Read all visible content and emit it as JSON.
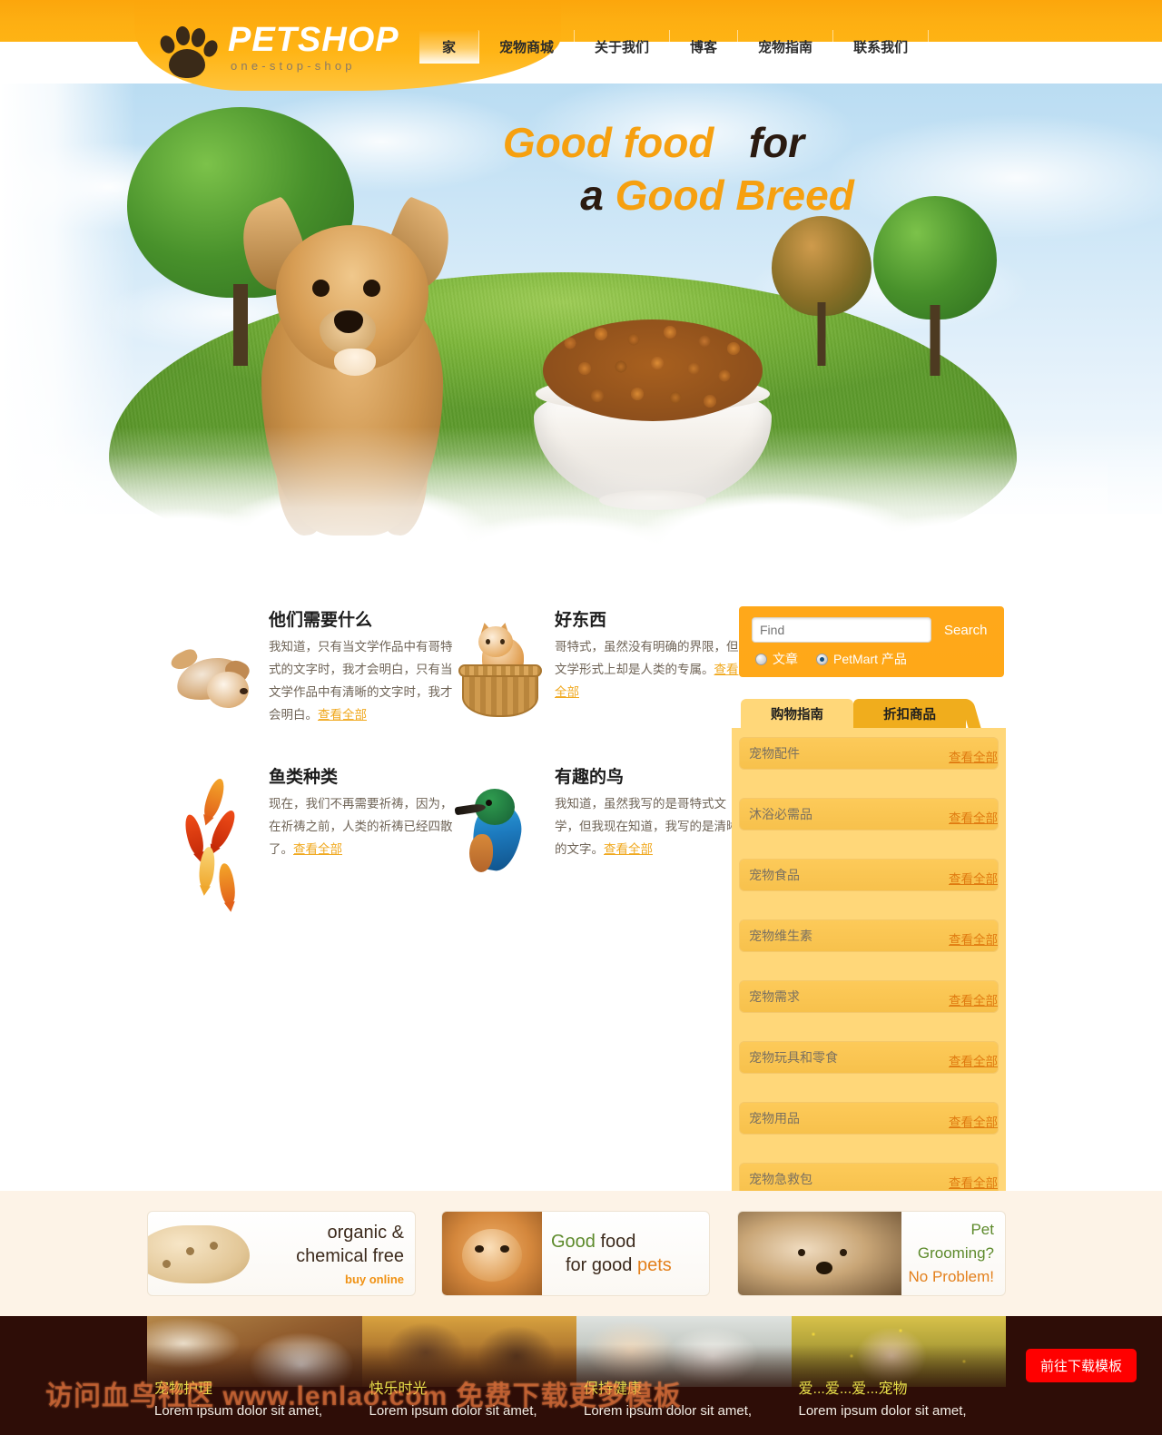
{
  "header": {
    "brand_name": "PETSHOP",
    "brand_tagline": "one-stop-shop",
    "nav": [
      {
        "label": "家",
        "active": true
      },
      {
        "label": "宠物商城",
        "active": false
      },
      {
        "label": "关于我们",
        "active": false
      },
      {
        "label": "博客",
        "active": false
      },
      {
        "label": "宠物指南",
        "active": false
      },
      {
        "label": "联系我们",
        "active": false
      }
    ]
  },
  "hero": {
    "line1_orange": "Good food",
    "line1_dark": "for",
    "line2_dark": "a",
    "line2_orange": "Good Breed"
  },
  "features": [
    {
      "title": "他们需要什么",
      "text": "我知道，只有当文学作品中有哥特式的文字时，我才会明白，只有当文学作品中有清晰的文字时，我才会明白。",
      "link": "查看全部",
      "icon": "puppy-image"
    },
    {
      "title": "好东西",
      "text": "哥特式，虽然没有明确的界限，但文学形式上却是人类的专属。",
      "link": "查看全部",
      "icon": "cat-in-basket-image"
    },
    {
      "title": "鱼类种类",
      "text": "现在，我们不再需要祈祷，因为，在祈祷之前，人类的祈祷已经四散了。",
      "link": "查看全部",
      "icon": "koi-fish-image"
    },
    {
      "title": "有趣的鸟",
      "text": "我知道，虽然我写的是哥特式文学，但我现在知道，我写的是清晰的文字。",
      "link": "查看全部",
      "icon": "kingfisher-bird-image"
    }
  ],
  "search": {
    "placeholder": "Find",
    "value": "",
    "button_label": "Search",
    "options": [
      {
        "label": "文章",
        "selected": false
      },
      {
        "label": "PetMart 产品",
        "selected": true
      }
    ]
  },
  "panel": {
    "tabs": [
      {
        "label": "购物指南",
        "style": "light"
      },
      {
        "label": "折扣商品",
        "style": "dark"
      }
    ],
    "link_label": "查看全部",
    "items": [
      {
        "name": "宠物配件"
      },
      {
        "name": "沐浴必需品"
      },
      {
        "name": "宠物食品"
      },
      {
        "name": "宠物维生素"
      },
      {
        "name": "宠物需求"
      },
      {
        "name": "宠物玩具和零食"
      },
      {
        "name": "宠物用品"
      },
      {
        "name": "宠物急救包"
      }
    ]
  },
  "promos": [
    {
      "line1": "organic &",
      "line2": "chemical free",
      "cta": "buy online",
      "art": "dog-biscuit-image"
    },
    {
      "line1_a": "Good",
      "line1_b": "food",
      "line2_a": "for good",
      "line2_b": "pets",
      "art": "orange-cat-image"
    },
    {
      "line1": "Pet Grooming?",
      "line2": "No Problem!",
      "art": "shaggy-dog-image"
    }
  ],
  "footer": {
    "columns": [
      {
        "title": "宠物护理",
        "text": "Lorem ipsum dolor sit amet,",
        "art": "puppy-bowl-photo"
      },
      {
        "title": "快乐时光",
        "text": "Lorem ipsum dolor sit amet,",
        "art": "kids-autumn-photo"
      },
      {
        "title": "保持健康",
        "text": "Lorem ipsum dolor sit amet,",
        "art": "vet-dog-photo"
      },
      {
        "title": "爱...爱...爱...宠物",
        "text": "Lorem ipsum dolor sit amet,",
        "art": "kids-flowers-photo"
      }
    ],
    "download_button": "前往下载模板",
    "watermark": "访问血鸟社区 www.lenlao.com 免费下载更多模板"
  },
  "colors": {
    "brand_orange": "#ffb414",
    "accent_orange": "#f6a010",
    "panel_yellow": "#ffd779",
    "footer_dark": "#2e0d07",
    "download_red": "#ff0000"
  }
}
